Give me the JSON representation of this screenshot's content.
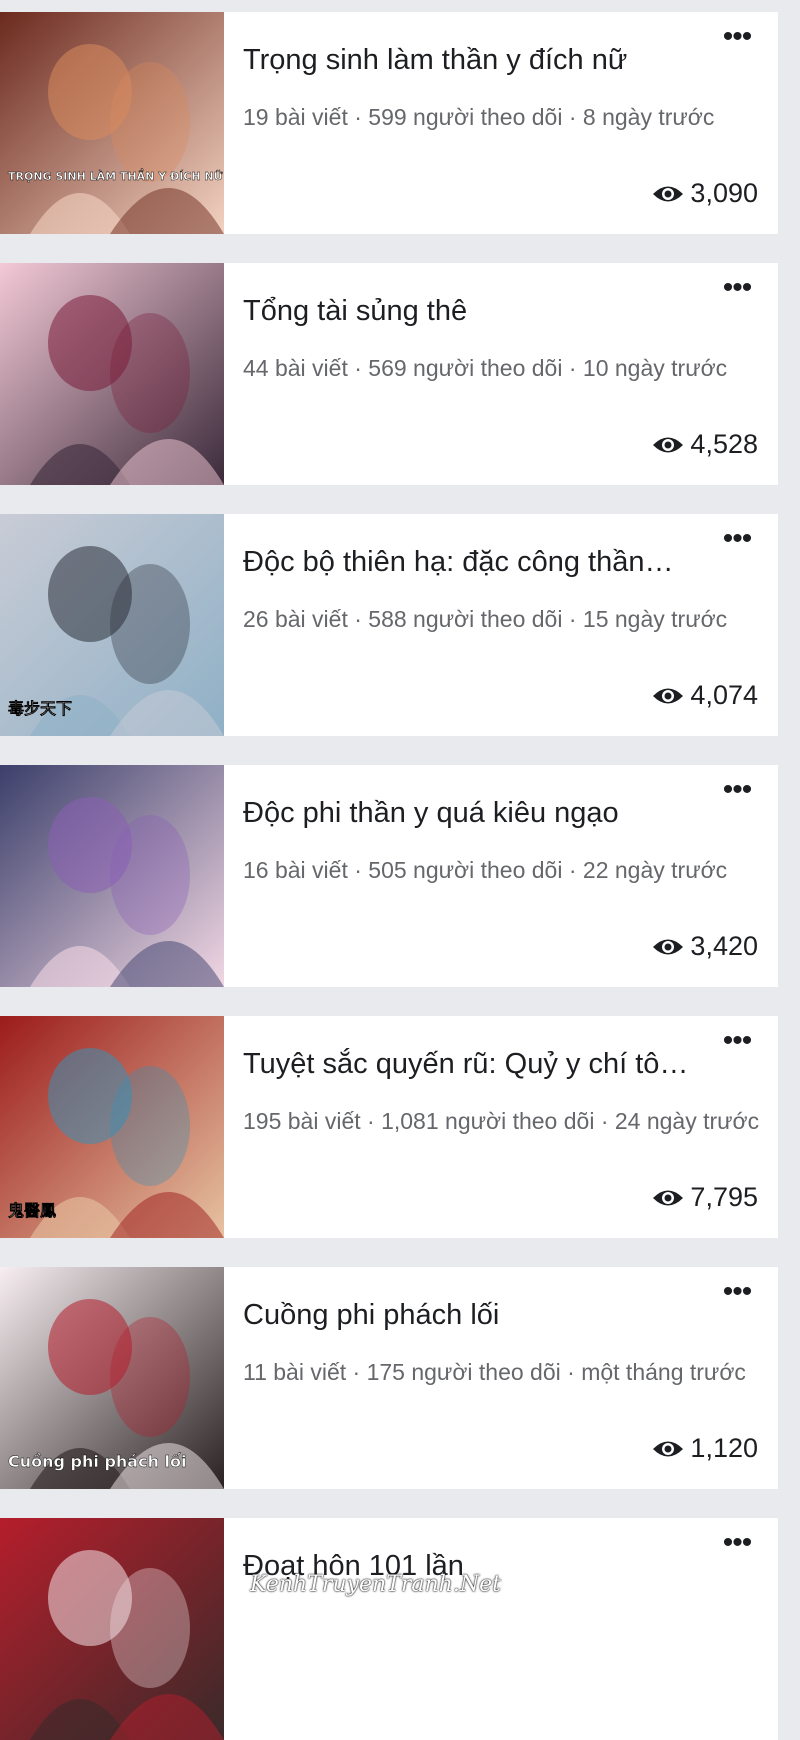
{
  "more_label": "•••",
  "items": [
    {
      "title": "Trọng sinh làm thần y đích nữ",
      "meta": "19 bài viết · 599 người theo dõi · 8 ngày trước",
      "views": "3,090",
      "cover_text": "TRỌNG SINH LÀM THẦN Y ĐÍCH NỮ",
      "colors": [
        "#6b2a1e",
        "#d98a5c",
        "#f3d2c1"
      ]
    },
    {
      "title": "Tổng tài sủng thê",
      "meta": "44 bài viết · 569 người theo dõi · 10 ngày trước",
      "views": "4,528",
      "cover_text": "",
      "colors": [
        "#f3c9d6",
        "#7a1e3a",
        "#3b2a3a"
      ]
    },
    {
      "title": "Độc bộ thiên hạ: đặc công thần…",
      "meta": "26 bài viết · 588 người theo dõi · 15 ngày trước",
      "views": "4,074",
      "cover_text": "毒步天下",
      "colors": [
        "#c9ccd6",
        "#2c2f3a",
        "#8fb0c6"
      ]
    },
    {
      "title": "Độc phi thần y quá kiêu ngạo",
      "meta": "16 bài viết · 505 người theo dõi · 22 ngày trước",
      "views": "3,420",
      "cover_text": "",
      "colors": [
        "#3b3f6b",
        "#8a5fb5",
        "#f1d7e3"
      ]
    },
    {
      "title": "Tuyệt sắc quyến rũ: Quỷ y chí tô…",
      "meta": "195 bài viết · 1,081 người theo dõi · 24 ngày trước",
      "views": "7,795",
      "cover_text": "鬼醫鳳",
      "colors": [
        "#9b1b1b",
        "#3a8fb5",
        "#e7c3a1"
      ]
    },
    {
      "title": "Cuồng phi phách lối",
      "meta": "11 bài viết · 175 người theo dõi · một tháng trước",
      "views": "1,120",
      "cover_text": "Cuồng phi phách lối",
      "colors": [
        "#f7eef1",
        "#b51e2b",
        "#2a2222"
      ]
    },
    {
      "title": "Đoạt hôn 101 lần",
      "meta": "",
      "views": "",
      "cover_text": "",
      "colors": [
        "#b51e2b",
        "#f4e2e6",
        "#3a2a2a"
      ]
    }
  ],
  "watermark": "KenhTruyenTranh.Net"
}
